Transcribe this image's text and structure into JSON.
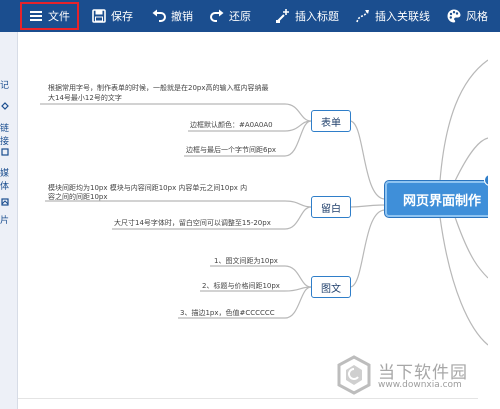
{
  "toolbar": {
    "file": "文件",
    "save": "保存",
    "undo": "撤销",
    "redo": "还原",
    "insert_title": "插入标题",
    "insert_link": "插入关联线",
    "style": "风格"
  },
  "left_strip": {
    "items": [
      "记",
      "链接",
      "媒体",
      "片"
    ]
  },
  "mindmap": {
    "central": "网页界面制作",
    "branches": [
      {
        "label": "表单",
        "notes": [
          "根据常用字号，制作表单的时候，一般就是在20px高的输入框内容纳最",
          "大14号最小12号的文字",
          "边框默认颜色：#A0A0A0",
          "边框与最后一个字节间距6px"
        ]
      },
      {
        "label": "留白",
        "notes": [
          "模块间距均为10px    模块与内容间距10px    内容单元之间10px      内",
          "容之间的间距10px",
          "大尺寸14号字体时，留白空间可以调整至15-20px"
        ]
      },
      {
        "label": "图文",
        "notes": [
          "1、图文间距为10px",
          "2、标题与价格间距10px",
          "3、描边1px，色值#CCCCCC"
        ]
      }
    ]
  },
  "watermark": {
    "name": "当下软件园",
    "url": "www.downxia.com"
  },
  "colors": {
    "toolbar_bg": "#1b4e8f",
    "central_bg": "#3f8fd9",
    "branch_line": "#b8b8b8",
    "highlight": "#e8232a"
  }
}
